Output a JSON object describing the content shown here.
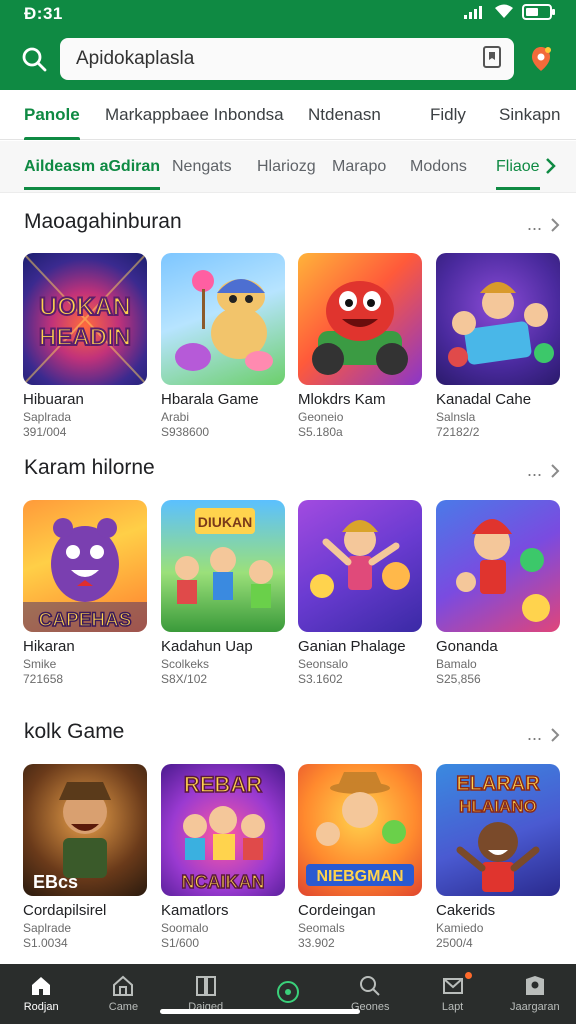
{
  "status_bar": {
    "time": "Ð:31"
  },
  "search": {
    "value": "Apidokaplasla"
  },
  "tabs": [
    {
      "label": "Panole",
      "active": true
    },
    {
      "label": "Markappbaee Inbondsa",
      "active": false
    },
    {
      "label": "Ntdenasn",
      "active": false
    },
    {
      "label": "Fidly",
      "active": false
    },
    {
      "label": "Sinkapn",
      "active": false
    }
  ],
  "chips": [
    {
      "label": "Aildeasm aGdiran",
      "active": true
    },
    {
      "label": "Nengats",
      "active": false
    },
    {
      "label": "Hlariozg",
      "active": false
    },
    {
      "label": "Marapo",
      "active": false
    },
    {
      "label": "Modons",
      "active": false
    },
    {
      "label": "Fliaoe",
      "active": false
    }
  ],
  "sections": [
    {
      "title": "Maoagahinburan",
      "more": "...",
      "apps": [
        {
          "name": "Hibuaran",
          "sub": "Saplrada",
          "downloads": "391/004",
          "icon_text": "UOKAN HEADIN"
        },
        {
          "name": "Hbarala Game",
          "sub": "Arabi",
          "downloads": "S938600",
          "icon_text": ""
        },
        {
          "name": "Mlokdrs Kam",
          "sub": "Geoneio",
          "downloads": "S5.180a",
          "icon_text": ""
        },
        {
          "name": "Kanadal Cahe",
          "sub": "Salnsla",
          "downloads": "72182/2",
          "icon_text": ""
        }
      ]
    },
    {
      "title": "Karam hilorne",
      "more": "...",
      "apps": [
        {
          "name": "Hikaran",
          "sub": "Smike",
          "downloads": "721658",
          "icon_text": "CAPEHAS"
        },
        {
          "name": "Kadahun Uap",
          "sub": "Scolkeks",
          "downloads": "S8X/102",
          "icon_text": "DIUKAN"
        },
        {
          "name": "Ganian Phalage",
          "sub": "Seonsalo",
          "downloads": "S3.1602",
          "icon_text": ""
        },
        {
          "name": "Gonanda",
          "sub": "Bamalo",
          "downloads": "S25,856",
          "icon_text": ""
        }
      ]
    },
    {
      "title": "kolk Game",
      "more": "...",
      "apps": [
        {
          "name": "Cordapilsirel",
          "sub": "Saplrade",
          "downloads": "S1.0034",
          "icon_text": "EBcs"
        },
        {
          "name": "Kamatlors",
          "sub": "Soomalo",
          "downloads": "S1/600",
          "icon_text": "REBAR NCAIKAN"
        },
        {
          "name": "Cordeingan",
          "sub": "Seomals",
          "downloads": "33.902",
          "icon_text": "NIEBGMAN"
        },
        {
          "name": "Cakerids",
          "sub": "Kamiedo",
          "downloads": "2500/4",
          "icon_text": "ELARAR HLAIANO"
        }
      ]
    }
  ],
  "bottom_nav": [
    {
      "label": "Rodjan",
      "icon": "home-icon",
      "active": true
    },
    {
      "label": "Came",
      "icon": "games-icon",
      "active": false
    },
    {
      "label": "Daiged",
      "icon": "apps-icon",
      "active": false
    },
    {
      "label": "",
      "icon": "center-icon",
      "active": false
    },
    {
      "label": "Geones",
      "icon": "search-icon",
      "active": false
    },
    {
      "label": "Lapt",
      "icon": "inbox-icon",
      "active": false
    },
    {
      "label": "Jaargaran",
      "icon": "account-icon",
      "active": false
    }
  ],
  "colors": {
    "brand": "#0f8a43",
    "nav_bg": "#2a2d2c"
  }
}
